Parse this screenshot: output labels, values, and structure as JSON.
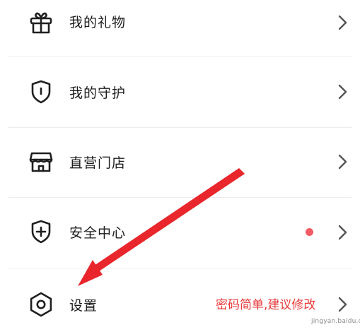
{
  "menu": {
    "items": [
      {
        "label": "我的礼物",
        "icon": "gift-icon"
      },
      {
        "label": "我的守护",
        "icon": "shield-icon"
      },
      {
        "label": "直营门店",
        "icon": "store-icon"
      },
      {
        "label": "安全中心",
        "icon": "shield-plus-icon",
        "badge_color": "#f25a64"
      },
      {
        "label": "设置",
        "icon": "gear-icon"
      }
    ]
  },
  "annotation": {
    "hint_text": "密码简单,建议修改",
    "arrow_color": "#e8262c"
  },
  "watermark": {
    "text": "jingyan.baidu.com"
  },
  "colors": {
    "text": "#1c1c1c",
    "icon": "#1f1f1f",
    "chevron": "#555555",
    "divider": "#ececec",
    "hint": "#e83a3a"
  }
}
